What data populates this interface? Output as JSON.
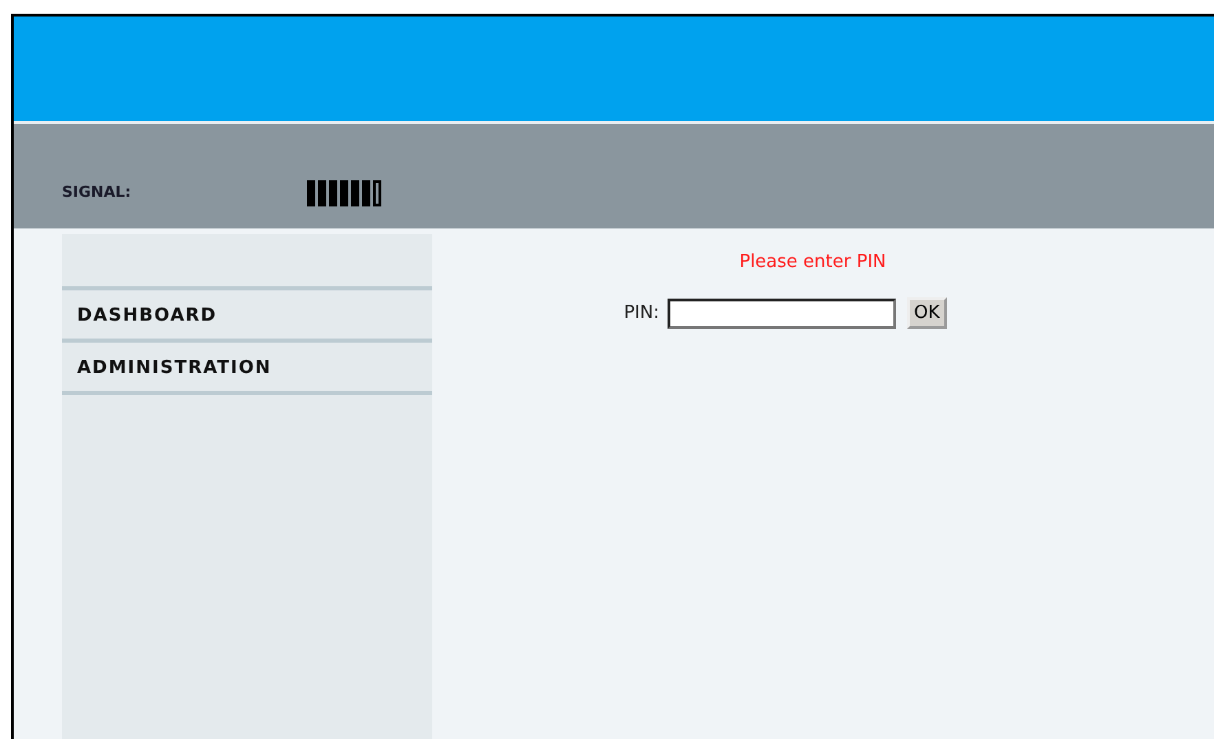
{
  "header": {
    "signal_label": "SIGNAL:"
  },
  "sidebar": {
    "items": [
      {
        "label": "DASHBOARD"
      },
      {
        "label": "ADMINISTRATION"
      }
    ]
  },
  "main": {
    "message": "Please enter PIN",
    "pin_label": "PIN:",
    "ok_button": "OK"
  }
}
